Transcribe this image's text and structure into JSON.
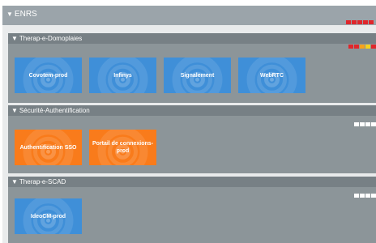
{
  "top": {
    "title": "ENRS",
    "indicator_colors": [
      "#e0262b",
      "#e0262b",
      "#e0262b",
      "#e0262b",
      "#e0262b"
    ]
  },
  "groups": [
    {
      "title": "Therap-e-Domoplaies",
      "indicator_colors": [
        "#e0262b",
        "#e0262b",
        "#f6a21b",
        "#f5d11c",
        "#e0262b"
      ],
      "tiles": [
        {
          "label": "Covotem-prod",
          "color": "#3f8fd8"
        },
        {
          "label": "Infinys",
          "color": "#3f8fd8"
        },
        {
          "label": "Signalement",
          "color": "#3f8fd8"
        },
        {
          "label": "WebRTC",
          "color": "#3f8fd8"
        }
      ]
    },
    {
      "title": "Sécurité-Authentification",
      "indicator_colors": [
        "#ffffff",
        "#ffffff",
        "#ffffff",
        "#ffffff"
      ],
      "tiles": [
        {
          "label": "Authentification SSO",
          "color": "#f97b1b"
        },
        {
          "label": "Portail de connexions-prod",
          "color": "#f97b1b"
        }
      ]
    },
    {
      "title": "Therap-e-SCAD",
      "indicator_colors": [
        "#ffffff",
        "#ffffff",
        "#ffffff",
        "#ffffff"
      ],
      "tiles": [
        {
          "label": "IdeoCM-prod",
          "color": "#3f8fd8"
        }
      ]
    }
  ]
}
